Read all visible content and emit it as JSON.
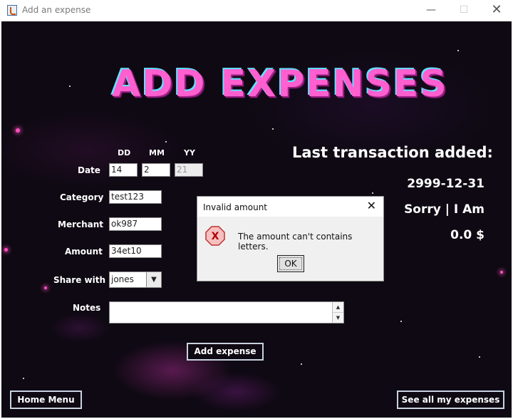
{
  "window": {
    "title": "Add an expense",
    "controls": {
      "minimize": "—",
      "maximize": "☐",
      "close": "✕"
    }
  },
  "banner": {
    "text": "ADD EXPENSES"
  },
  "form": {
    "date_label": "Date",
    "col_dd": "DD",
    "col_mm": "MM",
    "col_yy": "YY",
    "dd_value": "14",
    "mm_value": "2",
    "yy_value": "21",
    "category_label": "Category",
    "category_value": "test123",
    "merchant_label": "Merchant",
    "merchant_value": "ok987",
    "amount_label": "Amount",
    "amount_value": "34et10",
    "share_label": "Share with",
    "share_value": "jones",
    "notes_label": "Notes",
    "notes_value": ""
  },
  "buttons": {
    "add_expense": "Add expense",
    "home_menu": "Home Menu",
    "see_all": "See all my expenses"
  },
  "last_transaction": {
    "title": "Last transaction added:",
    "date": "2999-12-31",
    "name": "Sorry | I Am",
    "amount": "0.0 $"
  },
  "dialog": {
    "title": "Invalid amount",
    "close_glyph": "✕",
    "icon_glyph": "X",
    "message": "The amount can't contains letters.",
    "ok_label": "OK"
  },
  "colors": {
    "banner_pink": "#ff5fcf",
    "banner_cyan": "#5fe3ff",
    "background": "#0e0912"
  }
}
